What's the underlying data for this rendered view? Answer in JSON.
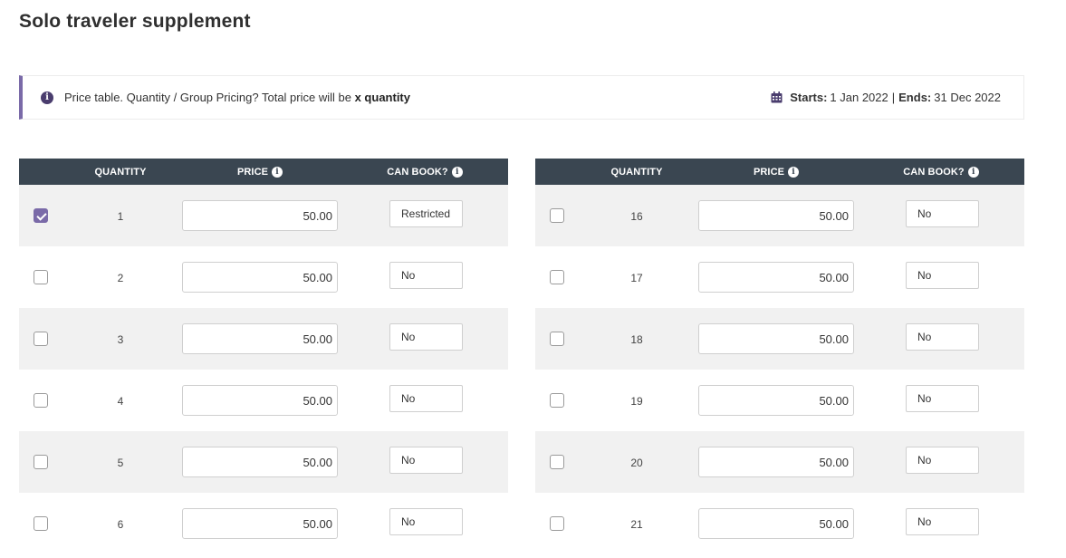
{
  "page": {
    "title": "Solo traveler supplement"
  },
  "info": {
    "text": "Price table. Quantity / Group Pricing? Total price will be",
    "bold": "x quantity",
    "starts_label": "Starts:",
    "starts_value": "1 Jan 2022",
    "separator": "|",
    "ends_label": "Ends:",
    "ends_value": "31 Dec 2022"
  },
  "table": {
    "headers": {
      "quantity": "QUANTITY",
      "price": "PRICE",
      "can_book": "CAN BOOK?"
    },
    "info_glyph": "i",
    "left_rows": [
      {
        "checked": true,
        "quantity": "1",
        "price": "50.00",
        "can_book": "Restricted"
      },
      {
        "checked": false,
        "quantity": "2",
        "price": "50.00",
        "can_book": "No"
      },
      {
        "checked": false,
        "quantity": "3",
        "price": "50.00",
        "can_book": "No"
      },
      {
        "checked": false,
        "quantity": "4",
        "price": "50.00",
        "can_book": "No"
      },
      {
        "checked": false,
        "quantity": "5",
        "price": "50.00",
        "can_book": "No"
      },
      {
        "checked": false,
        "quantity": "6",
        "price": "50.00",
        "can_book": "No"
      }
    ],
    "right_rows": [
      {
        "checked": false,
        "quantity": "16",
        "price": "50.00",
        "can_book": "No"
      },
      {
        "checked": false,
        "quantity": "17",
        "price": "50.00",
        "can_book": "No"
      },
      {
        "checked": false,
        "quantity": "18",
        "price": "50.00",
        "can_book": "No"
      },
      {
        "checked": false,
        "quantity": "19",
        "price": "50.00",
        "can_book": "No"
      },
      {
        "checked": false,
        "quantity": "20",
        "price": "50.00",
        "can_book": "No"
      },
      {
        "checked": false,
        "quantity": "21",
        "price": "50.00",
        "can_book": "No"
      }
    ]
  },
  "colors": {
    "accent": "#7a6aa8",
    "header_bg": "#3a4651",
    "shaded_row": "#f1f1f1"
  }
}
